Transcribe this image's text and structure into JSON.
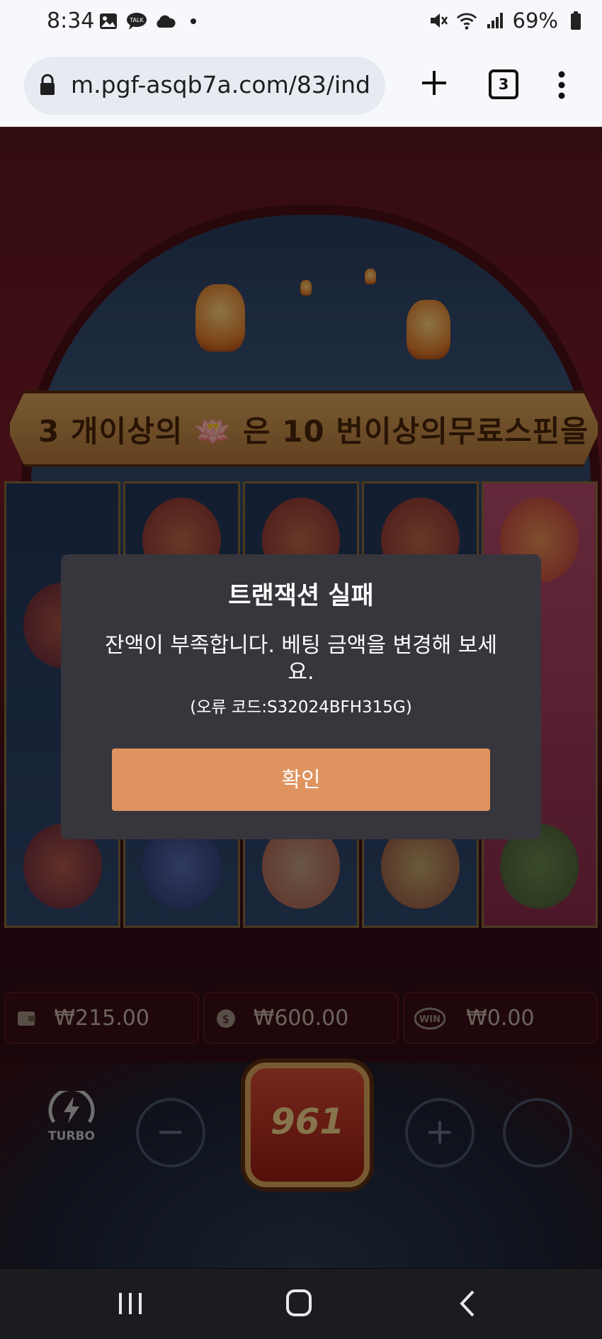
{
  "status_bar": {
    "time": "8:34",
    "battery": "69%",
    "left_icons": [
      "image-icon",
      "talk-icon",
      "cloud-icon",
      "dot-icon"
    ],
    "right_icons": [
      "mute-icon",
      "wifi-icon",
      "signal-icon",
      "battery-icon"
    ]
  },
  "browser": {
    "url": "m.pgf-asqb7a.com/83/ind",
    "tab_count": "3"
  },
  "game": {
    "banner": "3 개이상의 🪷 은 10 번이상의무료스핀을",
    "balance": "₩215.00",
    "bet": "₩600.00",
    "win": "₩0.00",
    "win_badge": "WIN",
    "spin_count": "961",
    "turbo_label": "TURBO"
  },
  "dialog": {
    "title": "트랜잭션 실패",
    "message": "잔액이 부족합니다. 베팅 금액을 변경해 보세요.",
    "error_code": "(오류 코드:S32024BFH315G)",
    "confirm_label": "확인"
  },
  "colors": {
    "dialog_bg": "#38363d",
    "confirm_button": "#df9460"
  }
}
